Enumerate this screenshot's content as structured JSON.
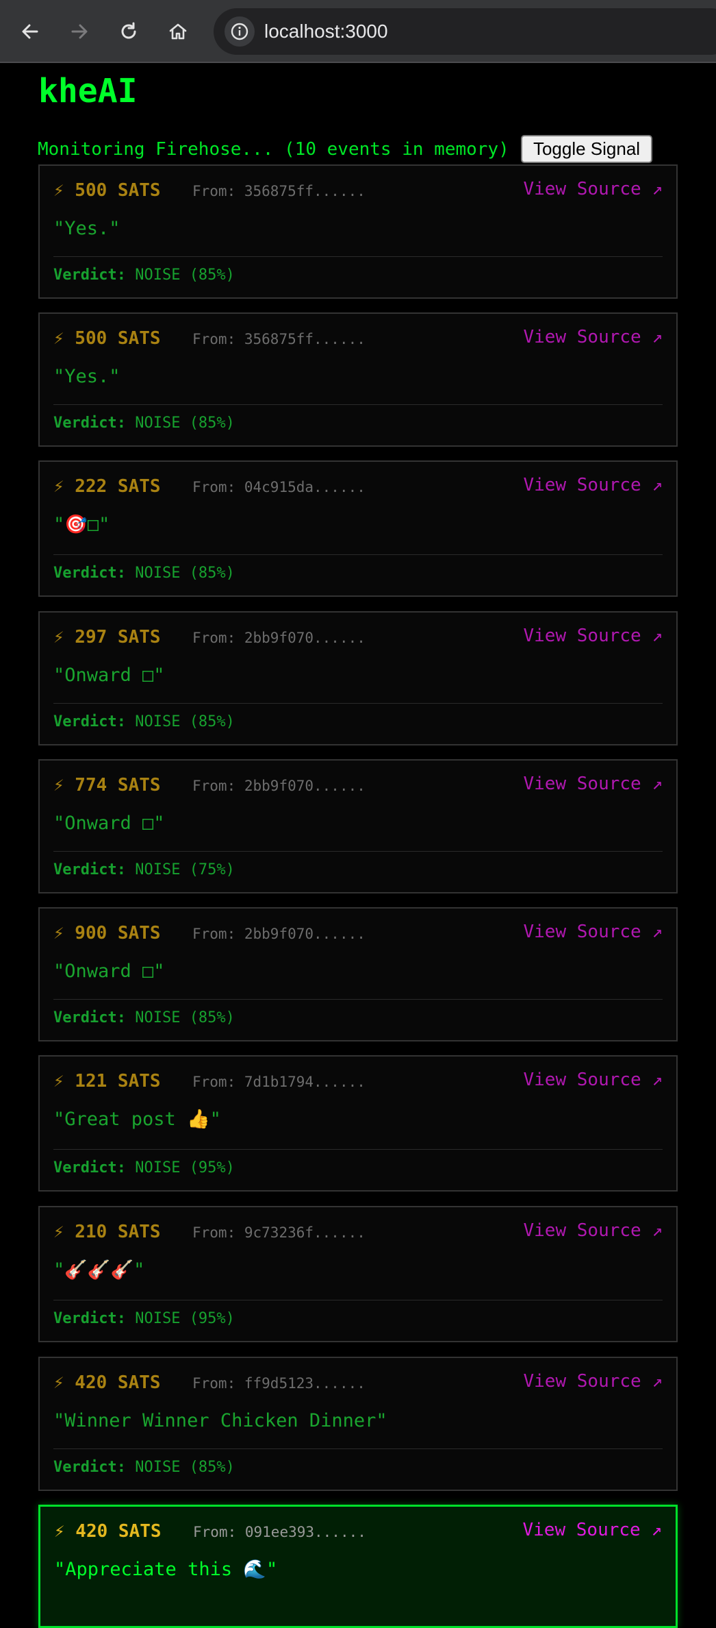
{
  "browser": {
    "url": "localhost:3000",
    "back_icon": "back-arrow-icon",
    "forward_icon": "forward-arrow-icon",
    "reload_icon": "reload-icon",
    "home_icon": "home-icon",
    "info_icon": "info-icon"
  },
  "app": {
    "title": "kheAI",
    "status": "Monitoring Firehose... (10 events in memory)",
    "toggle_label": "Toggle Signal"
  },
  "labels": {
    "from_prefix": "From:",
    "view_source": "View Source ↗",
    "verdict_label": "Verdict:"
  },
  "colors": {
    "accent_green": "#00ff2a",
    "sats_gold": "#a98212",
    "link_magenta": "#b018b0",
    "highlight_border": "#00e02a"
  },
  "events": [
    {
      "sats": "⚡ 500 SATS",
      "from": "356875ff......",
      "content": "\"Yes.\"",
      "verdict": "NOISE (85%)"
    },
    {
      "sats": "⚡ 500 SATS",
      "from": "356875ff......",
      "content": "\"Yes.\"",
      "verdict": "NOISE (85%)"
    },
    {
      "sats": "⚡ 222 SATS",
      "from": "04c915da......",
      "content": "\"🎯□\"",
      "verdict": "NOISE (85%)"
    },
    {
      "sats": "⚡ 297 SATS",
      "from": "2bb9f070......",
      "content": "\"Onward □\"",
      "verdict": "NOISE (85%)"
    },
    {
      "sats": "⚡ 774 SATS",
      "from": "2bb9f070......",
      "content": "\"Onward □\"",
      "verdict": "NOISE (75%)"
    },
    {
      "sats": "⚡ 900 SATS",
      "from": "2bb9f070......",
      "content": "\"Onward □\"",
      "verdict": "NOISE (85%)"
    },
    {
      "sats": "⚡ 121 SATS",
      "from": "7d1b1794......",
      "content": "\"Great post 👍\"",
      "verdict": "NOISE (95%)"
    },
    {
      "sats": "⚡ 210 SATS",
      "from": "9c73236f......",
      "content": "\"🎸🎸🎸\"",
      "verdict": "NOISE (95%)"
    },
    {
      "sats": "⚡ 420 SATS",
      "from": "ff9d5123......",
      "content": "\"Winner Winner Chicken Dinner\"",
      "verdict": "NOISE (85%)"
    },
    {
      "sats": "⚡ 420 SATS",
      "from": "091ee393......",
      "content": "\"Appreciate this 🌊\"",
      "highlighted": true
    }
  ]
}
